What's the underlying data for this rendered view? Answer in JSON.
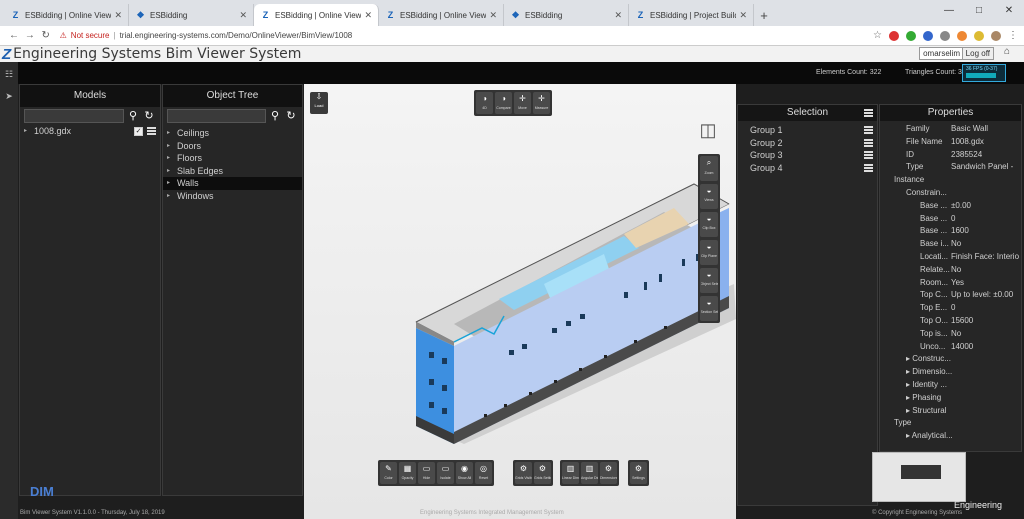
{
  "browser": {
    "tabs": [
      {
        "title": "ESBidding | Online Viewer - ESBi",
        "icon": "Z",
        "active": false
      },
      {
        "title": "ESBidding",
        "icon": "❖",
        "active": false
      },
      {
        "title": "ESBidding | Online Viewer - ESBi",
        "icon": "Z",
        "active": true
      },
      {
        "title": "ESBidding | Online Viewer - ESBi",
        "icon": "Z",
        "active": false
      },
      {
        "title": "ESBidding",
        "icon": "❖",
        "active": false
      },
      {
        "title": "ESBidding | Project Builder - ESB",
        "icon": "Z",
        "active": false
      }
    ],
    "new_tab": "+",
    "security": "Not secure",
    "url": "trial.engineering-systems.com/Demo/OnlineViewer/BimView/1008"
  },
  "app": {
    "logo": "Z",
    "title": "Engineering Systems Bim Viewer System",
    "user": "omarselim",
    "logoff": "Log off",
    "elements_count": "Elements Count: 322",
    "triangles_count": "Triangles Count: 354",
    "fps": "36 FPS (0-37)"
  },
  "models_panel": {
    "title": "Models",
    "items": [
      {
        "label": "1008.gdx",
        "checked": true
      }
    ]
  },
  "tree_panel": {
    "title": "Object Tree",
    "items": [
      {
        "label": "Ceilings",
        "selected": false
      },
      {
        "label": "Doors",
        "selected": false
      },
      {
        "label": "Floors",
        "selected": false
      },
      {
        "label": "Slab Edges",
        "selected": false
      },
      {
        "label": "Walls",
        "selected": true
      },
      {
        "label": "Windows",
        "selected": false
      }
    ]
  },
  "viewport": {
    "load_label": "Load",
    "top_tools": [
      {
        "icon": "◑",
        "label": "4D"
      },
      {
        "icon": "◑",
        "label": "Compare"
      },
      {
        "icon": "✛",
        "label": "Move"
      },
      {
        "icon": "✛",
        "label": "Measure"
      }
    ],
    "side_tools": [
      {
        "icon": "⌕",
        "label": "Zoom"
      },
      {
        "icon": "◒",
        "label": "Views"
      },
      {
        "icon": "◒",
        "label": "Clip Box"
      },
      {
        "icon": "◒",
        "label": "Clip Plane"
      },
      {
        "icon": "◒",
        "label": "Object Selection"
      },
      {
        "icon": "◒",
        "label": "Section Selection"
      }
    ],
    "bottom_group_1": [
      {
        "icon": "✎",
        "label": "Color"
      },
      {
        "icon": "▦",
        "label": "Opacity"
      },
      {
        "icon": "▭",
        "label": "Hide"
      },
      {
        "icon": "▭",
        "label": "Isolate"
      },
      {
        "icon": "◉",
        "label": "Show All"
      },
      {
        "icon": "◎",
        "label": "Reset"
      }
    ],
    "bottom_group_2": [
      {
        "icon": "⚙",
        "label": "Grids Visibility"
      },
      {
        "icon": "⚙",
        "label": "Grids Settings"
      }
    ],
    "bottom_group_3": [
      {
        "icon": "▥",
        "label": "Linear Dimensions"
      },
      {
        "icon": "▥",
        "label": "Angular Dimensions"
      },
      {
        "icon": "⚙",
        "label": "Dimensions Settings"
      }
    ],
    "bottom_group_4": [
      {
        "icon": "⚙",
        "label": "Settings"
      }
    ]
  },
  "selection_panel": {
    "title": "Selection",
    "groups": [
      "Group 1",
      "Group 2",
      "Group 3",
      "Group 4"
    ]
  },
  "properties_panel": {
    "title": "Properties",
    "rows": [
      {
        "indent": 2,
        "key": "Family",
        "value": "Basic Wall"
      },
      {
        "indent": 2,
        "key": "File Name",
        "value": "1008.gdx"
      },
      {
        "indent": 2,
        "key": "ID",
        "value": "2385524"
      },
      {
        "indent": 2,
        "key": "Type",
        "value": "Sandwich Panel -"
      },
      {
        "indent": 1,
        "key": "Instance",
        "value": ""
      },
      {
        "indent": 2,
        "key": "Constrain...",
        "value": ""
      },
      {
        "indent": 3,
        "key": "Base ...",
        "value": "±0.00"
      },
      {
        "indent": 3,
        "key": "Base ...",
        "value": "0"
      },
      {
        "indent": 3,
        "key": "Base ...",
        "value": "1600"
      },
      {
        "indent": 3,
        "key": "Base i...",
        "value": "No"
      },
      {
        "indent": 3,
        "key": "Locati...",
        "value": "Finish Face: Interio"
      },
      {
        "indent": 3,
        "key": "Relate...",
        "value": "No"
      },
      {
        "indent": 3,
        "key": "Room...",
        "value": "Yes"
      },
      {
        "indent": 3,
        "key": "Top C...",
        "value": "Up to level: ±0.00"
      },
      {
        "indent": 3,
        "key": "Top E...",
        "value": "0"
      },
      {
        "indent": 3,
        "key": "Top O...",
        "value": "15600"
      },
      {
        "indent": 3,
        "key": "Top is...",
        "value": "No"
      },
      {
        "indent": 3,
        "key": "Unco...",
        "value": "14000"
      },
      {
        "indent": 2,
        "key": "▸ Construc...",
        "value": ""
      },
      {
        "indent": 2,
        "key": "▸ Dimensio...",
        "value": ""
      },
      {
        "indent": 2,
        "key": "▸ Identity ...",
        "value": ""
      },
      {
        "indent": 2,
        "key": "▸ Phasing",
        "value": ""
      },
      {
        "indent": 2,
        "key": "▸ Structural",
        "value": ""
      },
      {
        "indent": 1,
        "key": "Type",
        "value": ""
      },
      {
        "indent": 2,
        "key": "▸ Analytical...",
        "value": ""
      }
    ]
  },
  "footer": {
    "left": "Bim Viewer System V1.1.0.0 - Thursday, July 18, 2019",
    "center": "Engineering Systems Integrated Management System",
    "right": "© Copyright Engineering Systems",
    "brand": "Engineering",
    "dim_logo": "DIM"
  },
  "colors": {
    "accent": "#1c5fb0",
    "facade_blue": "#3d8fe0",
    "panel_bg": "#262626"
  }
}
